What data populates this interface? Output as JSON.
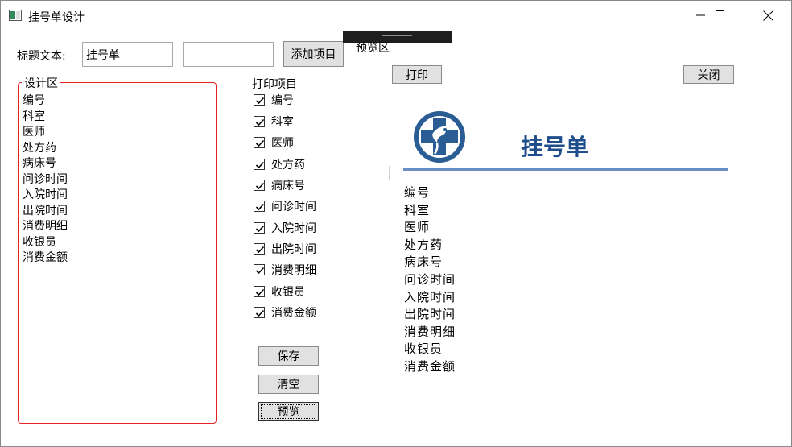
{
  "window": {
    "title": "挂号单设计",
    "icon": "app-window-icon",
    "controls": [
      "minimize-icon",
      "maximize-icon",
      "close-icon"
    ]
  },
  "form": {
    "title_label": "标题文本:",
    "title_value": "挂号单",
    "item_value": "",
    "add_button": "添加项目"
  },
  "design_area": {
    "legend": "设计区",
    "items": [
      "编号",
      "科室",
      "医师",
      "处方药",
      "病床号",
      "问诊时间",
      "入院时间",
      "出院时间",
      "消费明细",
      "收银员",
      "消费金额"
    ]
  },
  "print_items": {
    "label": "打印项目",
    "items": [
      {
        "label": "编号",
        "checked": true
      },
      {
        "label": "科室",
        "checked": true
      },
      {
        "label": "医师",
        "checked": true
      },
      {
        "label": "处方药",
        "checked": true
      },
      {
        "label": "病床号",
        "checked": true
      },
      {
        "label": "问诊时间",
        "checked": true
      },
      {
        "label": "入院时间",
        "checked": true
      },
      {
        "label": "出院时间",
        "checked": true
      },
      {
        "label": "消费明细",
        "checked": true
      },
      {
        "label": "收银员",
        "checked": true
      },
      {
        "label": "消费金额",
        "checked": true
      }
    ],
    "save_button": "保存",
    "clear_button": "清空",
    "preview_button": "预览"
  },
  "preview": {
    "label": "预览区",
    "print_button": "打印",
    "close_button": "关闭",
    "logo": "medical-cross-logo-icon",
    "doc_title": "挂号单",
    "items": [
      "编号",
      "科室",
      "医师",
      "处方药",
      "病床号",
      "问诊时间",
      "入院时间",
      "出院时间",
      "消费明细",
      "收银员",
      "消费金额"
    ],
    "accent_color": "#1f4e8c",
    "rule_color": "#6a8fc7"
  },
  "design_border_color": "#e32222"
}
